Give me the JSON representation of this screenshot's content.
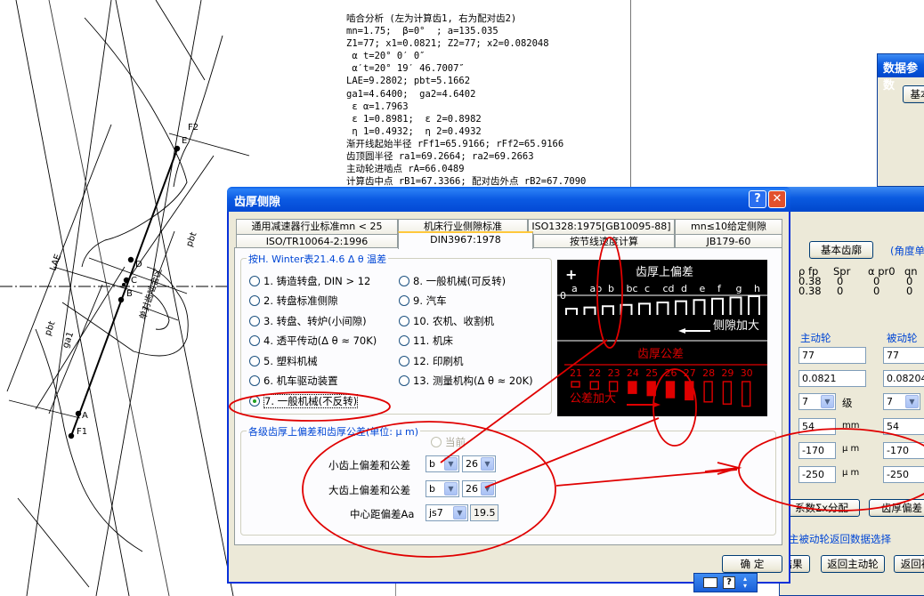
{
  "analysis": {
    "lines": [
      "啮合分析 (左为计算齿1, 右为配对齿2)",
      "mn=1.75;  β=0°  ; a=135.035",
      "Z1=77; x1=0.0821; Z2=77; x2=0.082048",
      " α t=20° 0′ 0″",
      " α′t=20° 19′ 46.7007″",
      "LAE=9.2802; pbt=5.1662",
      "ga1=4.6400;  ga2=4.6402",
      " ε α=1.7963",
      " ε 1=0.8981;  ε 2=0.8982",
      " η 1=0.4932;  η 2=0.4932",
      "渐开线起始半径 rFf1=65.9166; rFf2=65.9166",
      "齿顶圆半径 ra1=69.2664; ra2=69.2663",
      "主动轮进啮点 rA=66.0489",
      "计算齿中点 rB1=67.3366; 配对齿外点 rB2=67.7090"
    ]
  },
  "drawing": {
    "point_labels": [
      "F2",
      "E",
      "D",
      "C",
      "B",
      "A",
      "F1"
    ],
    "dim_labels": [
      "LAE",
      "pbt",
      "ga1",
      "pbt",
      "单对齿啮合区"
    ]
  },
  "bg_window1": {
    "title": "数据参数",
    "button": "基本"
  },
  "bg_window2": {
    "basic_profile_button": "基本齿廓",
    "angle_unit_note": "(角度单",
    "headers": [
      "ρ fp",
      "Spr",
      "α pr0",
      "qn"
    ],
    "row1": [
      "0.38",
      "0",
      "0",
      "0"
    ],
    "row2": [
      "0.38",
      "0",
      "0",
      "0"
    ],
    "driving_label": "主动轮",
    "driven_label": "被动轮",
    "driving": {
      "z": "77",
      "x": "0.0821",
      "grade": "7",
      "grade_unit": "级",
      "b": "54",
      "b_unit": "mm",
      "esu": "-170",
      "esu_unit": "μ m",
      "esi": "-250",
      "esi_unit": "μ m"
    },
    "driven": {
      "z": "77",
      "x": "0.082048",
      "grade": "7",
      "b": "54",
      "esu": "-170",
      "esi": "-250"
    },
    "btn_sigma": "系数Σx分配",
    "btn_thickness": "齿厚偏差",
    "return_select_label": "主被动轮返回数据选择",
    "btn_result": "结果",
    "btn_return_driving": "返回主动轮",
    "btn_return_driven": "返回被"
  },
  "dialog": {
    "title": "齿厚侧隙",
    "help_button": "?",
    "close_button": "✕",
    "tabs_row1": [
      "通用减速器行业标准mn < 25",
      "机床行业侧隙标准",
      "ISO1328:1975[GB10095-88]",
      "mn≤10给定侧隙"
    ],
    "tabs_row2": [
      "ISO/TR10064-2:1996",
      "DIN3967:1978",
      "按节线速度计算",
      "JB179-60"
    ],
    "group1_title": "按H. Winter表21.4.6 Δ θ 温差",
    "options_left": [
      "1. 铸造转盘, DIN > 12",
      "2. 转盘标准侧隙",
      "3. 转盘、转炉(小间隙)",
      "4. 透平传动(Δ θ  ≈  70K)",
      "5. 塑料机械",
      "6. 机车驱动装置",
      "7. 一般机械(不反转)"
    ],
    "options_right": [
      "8. 一般机械(可反转)",
      "9. 汽车",
      "10. 农机、收割机",
      "11. 机床",
      "12. 印刷机",
      "13. 测量机构(Δ θ  ≈  20K)"
    ],
    "selected_option": 7,
    "group2_title": "各级齿厚上偏差和齿厚公差(单位: μ m)",
    "current_label": "当前",
    "small_gear_label": "小齿上偏差和公差",
    "large_gear_label": "大齿上偏差和公差",
    "center_label": "中心距偏差Aa",
    "small_dev": "b",
    "small_tol": "26",
    "large_dev": "b",
    "large_tol": "26",
    "center_fit": "js7",
    "center_value": "19.5",
    "ok_button": "确  定"
  },
  "chart": {
    "top_title": "齿厚上偏差",
    "plus": "+",
    "minus": "−",
    "zero": "0",
    "letters": [
      "a",
      "ab",
      "b",
      "bc",
      "c",
      "cd",
      "d",
      "e",
      "f",
      "g",
      "h"
    ],
    "backlash_note": "侧隙加大",
    "bottom_title": "齿厚公差",
    "grades": [
      "21",
      "22",
      "23",
      "24",
      "25",
      "26",
      "27",
      "28",
      "29",
      "30"
    ],
    "tol_note": "公差加大"
  },
  "colors": {
    "annotation": "#e00000",
    "title_blue": "#0a5ae0",
    "group_title": "#0046d5"
  }
}
